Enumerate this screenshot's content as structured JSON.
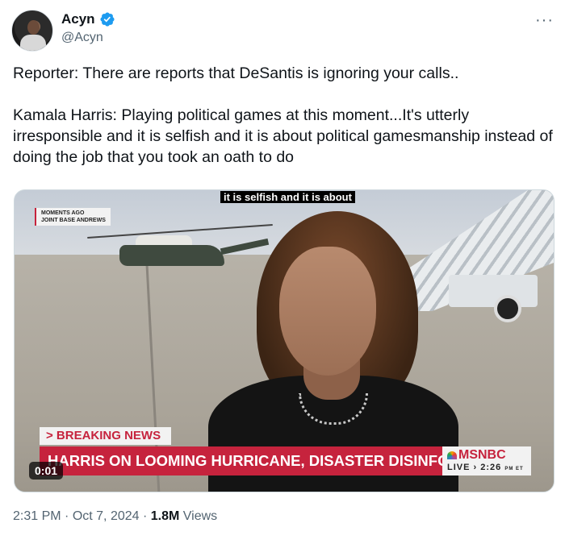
{
  "author": {
    "name": "Acyn",
    "handle": "@Acyn",
    "verified_color": "#1d9bf0"
  },
  "more_icon": "more-horizontal-icon",
  "tweet": {
    "paragraph1": "Reporter: There are reports that DeSantis is ignoring your calls..",
    "paragraph2": "Kamala Harris: Playing political games at this moment...It's utterly irresponsible and it is selfish and it is about political gamesmanship instead of doing the job that you took an oath to do"
  },
  "video": {
    "caption": "it is selfish and it is about",
    "badge_line1": "MOMENTS AGO",
    "badge_line2": "JOINT BASE ANDREWS",
    "breaking": "> BREAKING NEWS",
    "headline": "HARRIS ON LOOMING HURRICANE, DISASTER DISINFORMATION",
    "network": "MSNBC",
    "live": "LIVE › 2:26",
    "live_suffix": "PM ET",
    "timer": "0:01"
  },
  "meta": {
    "time": "2:31 PM",
    "separator": " · ",
    "date": "Oct 7, 2024",
    "views_count": "1.8M",
    "views_label": " Views"
  }
}
